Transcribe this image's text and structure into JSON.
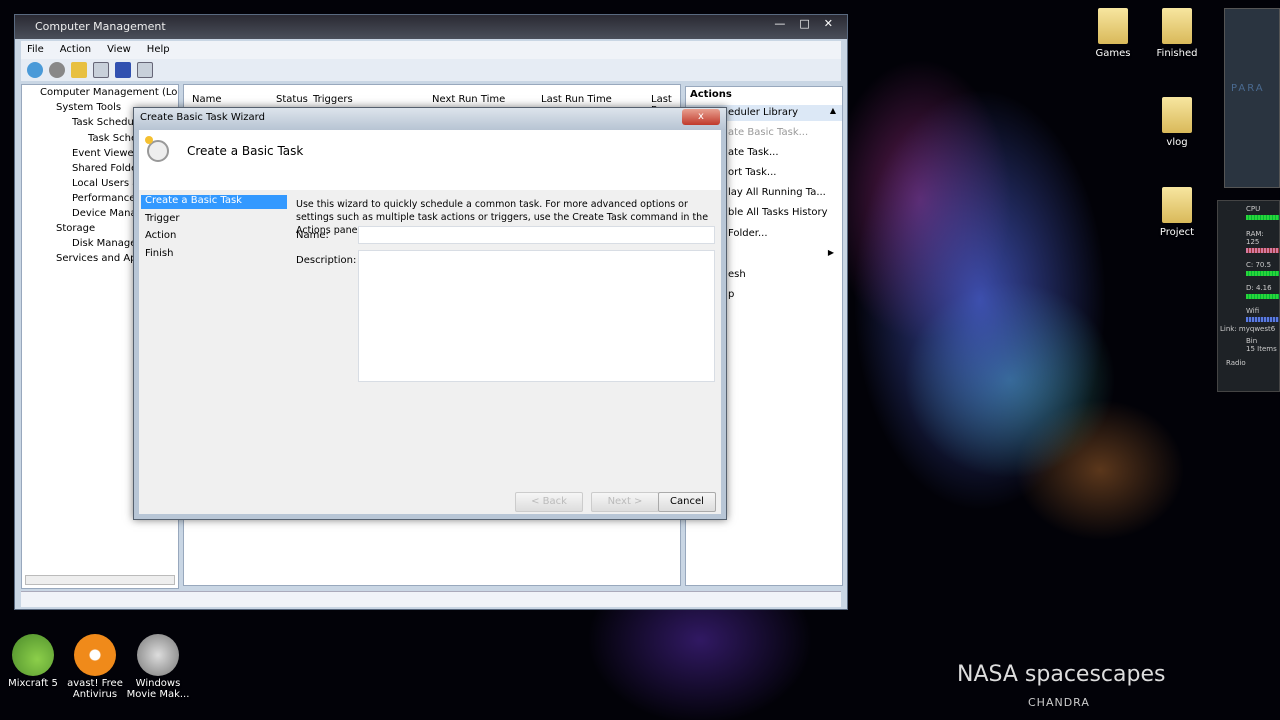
{
  "main_window": {
    "title": "Computer Management",
    "menu": [
      "File",
      "Action",
      "View",
      "Help"
    ],
    "tree": [
      "Computer Management (Local",
      "System Tools",
      "Task Schedule",
      "Task Sche",
      "Event Viewer",
      "Shared Folder",
      "Local Users a",
      "Performance",
      "Device Manag",
      "Storage",
      "Disk Manager",
      "Services and App"
    ],
    "columns": [
      "Name",
      "Status",
      "Triggers",
      "Next Run Time",
      "Last Run Time",
      "Last R"
    ],
    "actions_header": "Actions",
    "actions": [
      "eduler Library",
      "ate Basic Task...",
      "ate Task...",
      "ort Task...",
      "lay All Running Ta...",
      "ble All Tasks History",
      "Folder...",
      "",
      "esh",
      "p"
    ]
  },
  "dialog": {
    "title": "Create Basic Task Wizard",
    "close": "x",
    "heading": "Create a Basic Task",
    "nav": [
      "Create a Basic Task",
      "Trigger",
      "Action",
      "Finish"
    ],
    "intro": "Use this wizard to quickly schedule a common task.  For more advanced options or settings such as multiple task actions or triggers, use the Create Task command in the Actions pane.",
    "name_label": "Name:",
    "name_value": "",
    "description_label": "Description:",
    "description_value": "",
    "back": "< Back",
    "next": "Next >",
    "cancel": "Cancel"
  },
  "desktop": {
    "icons_right": [
      "Games",
      "Finished",
      "vlog",
      "Project"
    ],
    "icons_bottom": [
      "Mixcraft 5",
      "avast! Free Antivirus",
      "Windows Movie Mak..."
    ],
    "widget": {
      "cpu": "CPU",
      "ram": "RAM: 125",
      "c": "C:  70.5",
      "d": "D:  4.16",
      "wifi": "Wifi",
      "link": "Link: myqwest6",
      "bin": "Bin",
      "items": "15 Items",
      "radio": "Radio"
    },
    "player_title": "PARA",
    "wallpaper_title": "NASA spacescapes",
    "wallpaper_sub": "CHANDRA"
  },
  "colors": {
    "selection": "#3399ff",
    "close": "#c0392b"
  }
}
